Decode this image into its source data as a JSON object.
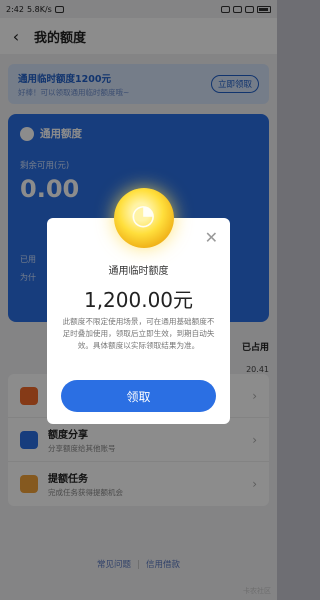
{
  "statusbar": {
    "time": "2:42",
    "speed": "5.8K/s",
    "battery": ""
  },
  "nav": {
    "title": "我的额度"
  },
  "banner": {
    "title": "通用临时额度1200元",
    "subtitle": "好棒！可以领取通用临时额度哦~",
    "button": "立即领取"
  },
  "card": {
    "title": "通用额度",
    "available_label": "剩余可用(元)",
    "available_value": "0.00",
    "used_label": "已用",
    "footer_left": "为什"
  },
  "side": {
    "used_text": "已占用",
    "used_value": "20.41"
  },
  "list": [
    {
      "icon": "orange-icon",
      "title": "",
      "subtitle": "",
      "color": "#f26b2a"
    },
    {
      "icon": "share-icon",
      "title": "额度分享",
      "subtitle": "分享额度给其他账号",
      "color": "#2b6fe3"
    },
    {
      "icon": "gift-icon",
      "title": "提额任务",
      "subtitle": "完成任务获得提额机会",
      "color": "#f2a23a"
    }
  ],
  "footer": {
    "left": "常见问题",
    "right": "信用借款"
  },
  "watermark": "卡农社区",
  "modal": {
    "title": "通用临时额度",
    "amount": "1,200.00元",
    "desc": "此额度不限定使用场景，可在通用基础额度不足时叠加使用，领取后立即生效，到期自动失效。具体额度以实际领取结果为准。",
    "button": "领取"
  }
}
